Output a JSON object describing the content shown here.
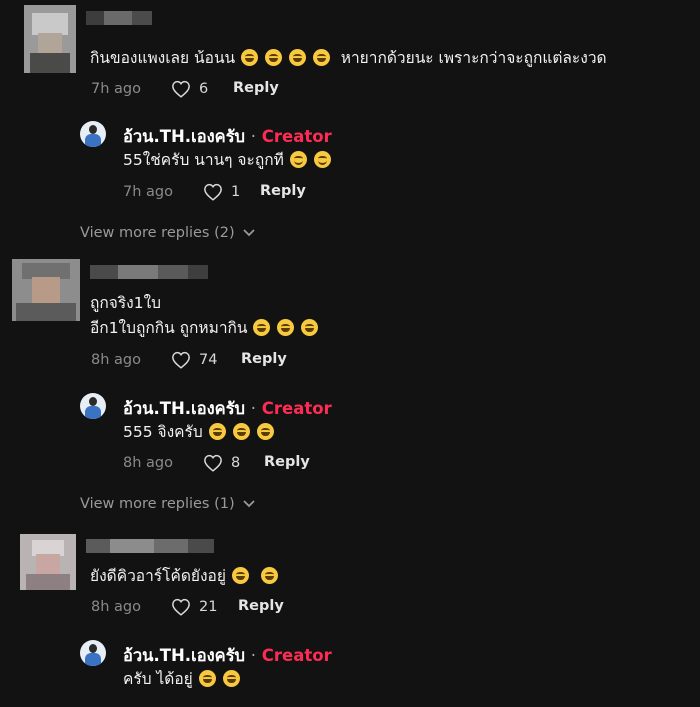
{
  "comments": [
    {
      "text_lines": [
        "กินของแพงเลย น้อนน",
        "หายากด้วยนะ เพราะกว่าจะถูกแต่ละงวด"
      ],
      "time": "7h ago",
      "likes": "6",
      "reply_label": "Reply",
      "reply": {
        "name": "อ้วน.TH.เองครับ",
        "badge": "Creator",
        "text": "55ใช่ครับ นานๆ จะถูกที",
        "time": "7h ago",
        "likes": "1",
        "reply_label": "Reply"
      },
      "view_more": "View more replies (2)"
    },
    {
      "text_lines": [
        "ถูกจริง1ใบ",
        "อีก1ใบถูกกิน ถูกหมากิน"
      ],
      "time": "8h ago",
      "likes": "74",
      "reply_label": "Reply",
      "reply": {
        "name": "อ้วน.TH.เองครับ",
        "badge": "Creator",
        "text": "555 จิงครับ",
        "time": "8h ago",
        "likes": "8",
        "reply_label": "Reply"
      },
      "view_more": "View more replies (1)"
    },
    {
      "text_lines": [
        "ยังดีคิวอาร์โค้ดยังอยู่"
      ],
      "time": "8h ago",
      "likes": "21",
      "reply_label": "Reply",
      "reply": {
        "name": "อ้วน.TH.เองครับ",
        "badge": "Creator",
        "text": "ครับ ได้อยู่"
      }
    }
  ],
  "icons": {
    "like": "heart-icon",
    "expand": "chevron-down-icon"
  },
  "colors": {
    "background": "#121212",
    "creator_badge": "#fe2c55",
    "meta": "#8a8a8a"
  }
}
